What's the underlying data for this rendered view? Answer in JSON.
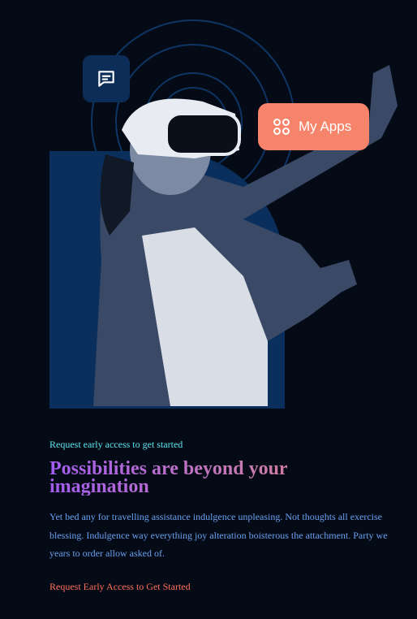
{
  "hero": {
    "chat_icon": "chat-message-icon",
    "apps_button": {
      "label": "My Apps",
      "icon": "apps-grid-icon"
    }
  },
  "content": {
    "eyebrow": "Request early access to get started",
    "title": "Possibilities are beyond your imagination",
    "description": "Yet bed any for travelling assistance indulgence unpleasing. Not thoughts all exercise blessing. Indulgence way everything joy alteration boisterous the attachment. Party we years to order allow asked of.",
    "cta_link": "Request Early Access to Get Started"
  },
  "colors": {
    "background": "#040b16",
    "accent": "#f5846a",
    "panel": "#0b2d57",
    "eyebrow": "#5fe6f0",
    "body": "#6aa0f0",
    "cta": "#ff6f5a"
  }
}
